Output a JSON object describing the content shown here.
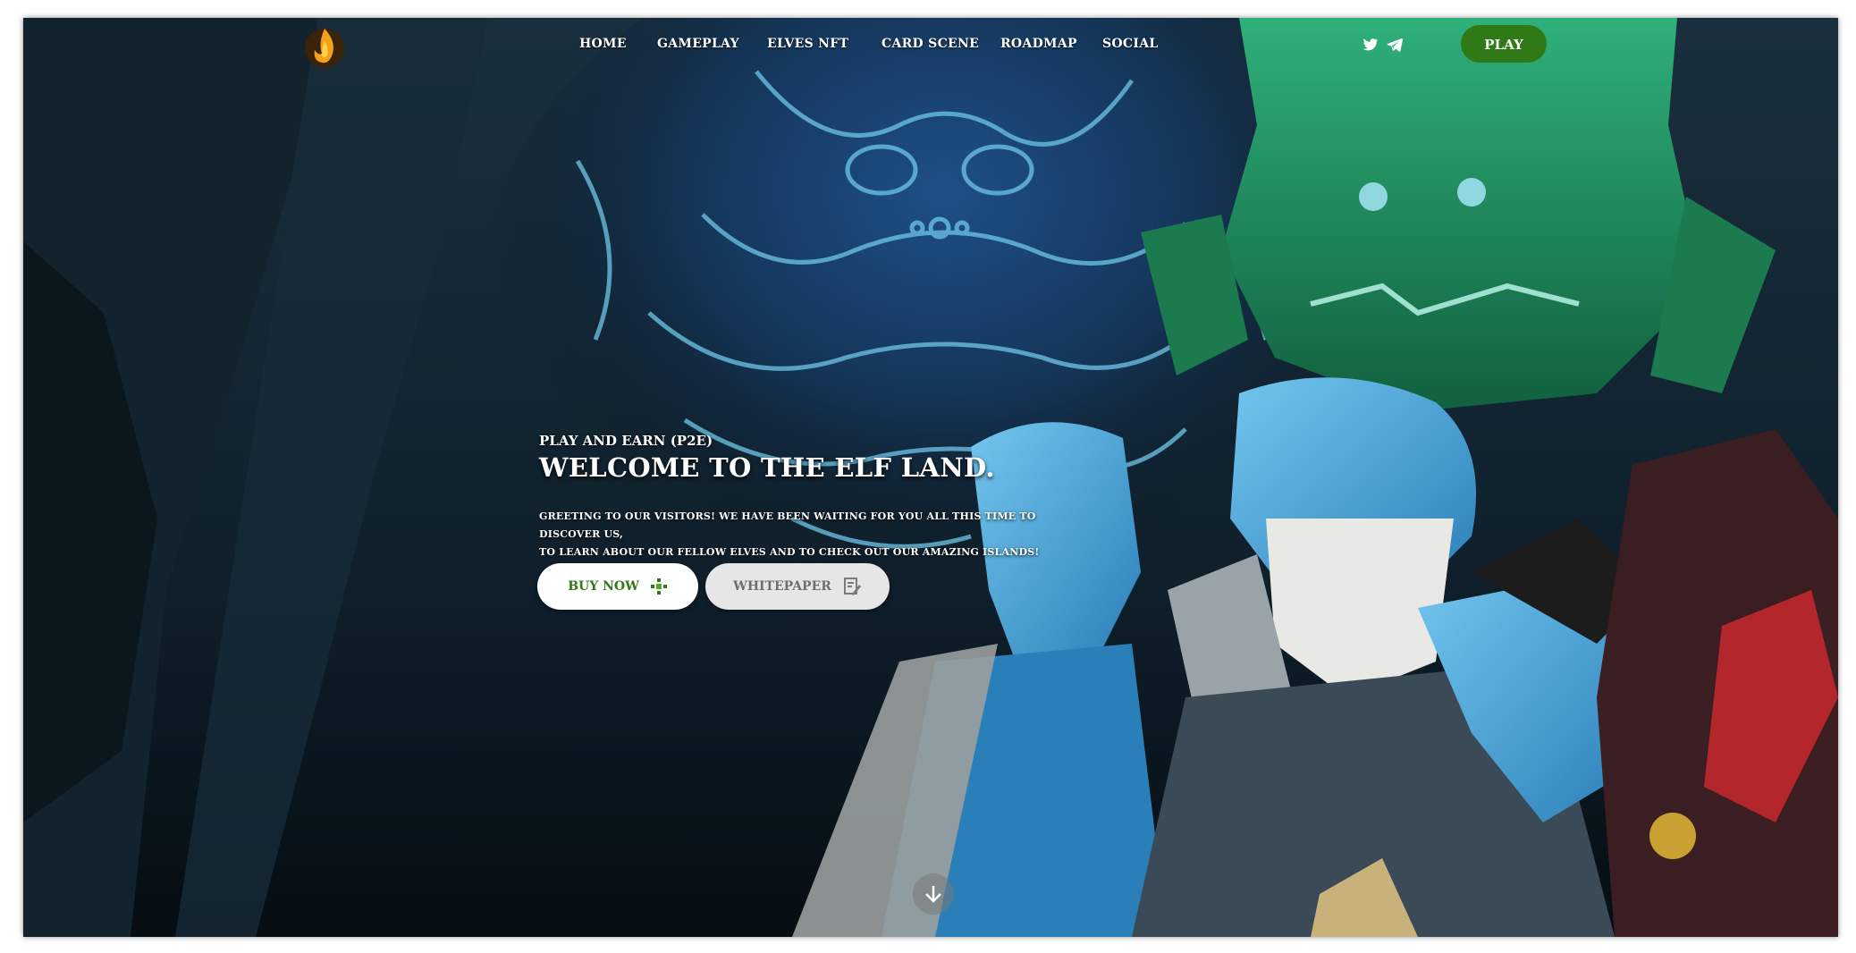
{
  "navbar": {
    "items": [
      {
        "label": "HOME"
      },
      {
        "label": "GAMEPLAY"
      },
      {
        "label": "ELVES NFT"
      },
      {
        "label": "CARD SCENE"
      },
      {
        "label": "ROADMAP"
      },
      {
        "label": "SOCIAL"
      }
    ],
    "social_icons": [
      "twitter-icon",
      "telegram-icon"
    ],
    "play_label": "PLAY"
  },
  "hero": {
    "tagline": "PLAY AND EARN (P2E)",
    "title": "WELCOME TO THE ELF LAND.",
    "description_line1": "GREETING TO OUR VISITORS! WE HAVE BEEN WAITING FOR YOU ALL THIS TIME TO DISCOVER US,",
    "description_line2": "TO LEARN ABOUT OUR FELLOW ELVES AND TO CHECK OUT OUR AMAZING ISLANDS!",
    "buy_label": "BUY NOW",
    "whitepaper_label": "WHITEPAPER"
  },
  "icons": {
    "logo": "flame-logo-icon",
    "buy": "sparkle-icon",
    "whitepaper": "document-edit-icon",
    "scroll": "arrow-down-icon"
  },
  "colors": {
    "accent_green": "#2f7a17",
    "background_dark": "#0c1a24",
    "rune_blue": "#6fc7e8"
  }
}
